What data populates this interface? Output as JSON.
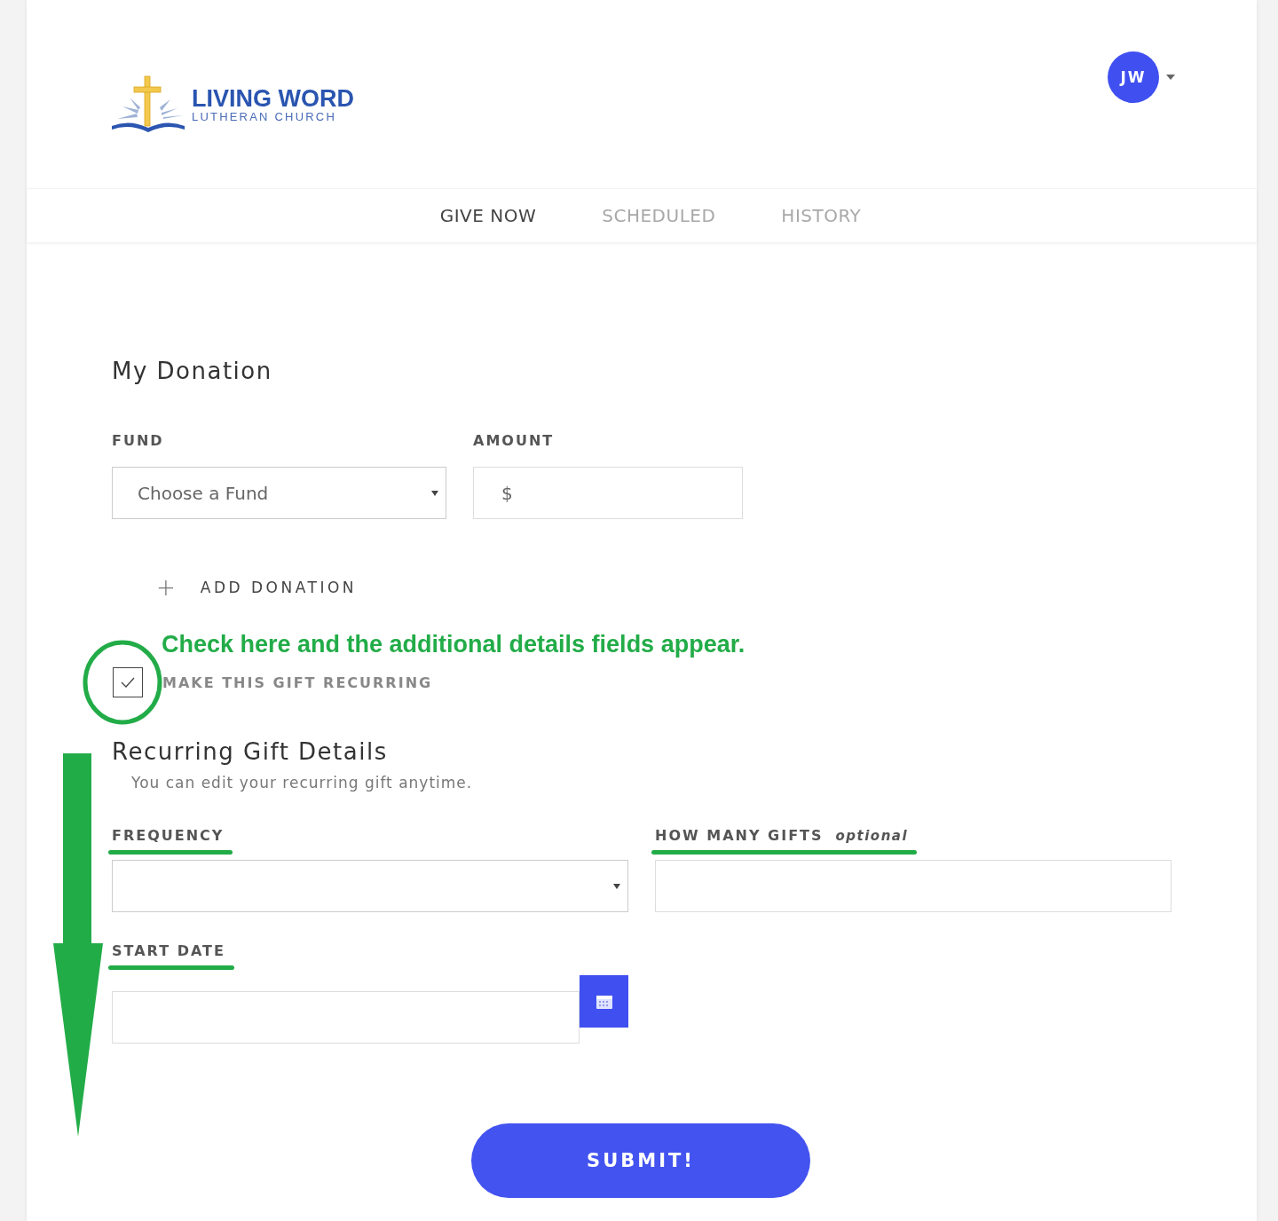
{
  "header": {
    "logo": {
      "title": "LIVING WORD",
      "subtitle": "LUTHERAN CHURCH"
    },
    "avatar": {
      "initials": "JW"
    }
  },
  "tabs": [
    {
      "label": "GIVE NOW",
      "selected": true
    },
    {
      "label": "SCHEDULED",
      "selected": false
    },
    {
      "label": "HISTORY",
      "selected": false
    }
  ],
  "donation": {
    "heading": "My Donation",
    "fields": [
      {
        "kind": "select",
        "label": "FUND",
        "placeholder": "Choose a Fund"
      },
      {
        "kind": "currency",
        "label": "AMOUNT",
        "prefix": "$"
      }
    ],
    "add_button": {
      "icon": "+",
      "label": "ADD DONATION"
    }
  },
  "annotation": {
    "text": "Check here and the additional details fields appear."
  },
  "recurring_checkbox": {
    "label": "MAKE THIS GIFT RECURRING",
    "checked": true,
    "highlighted": true
  },
  "recurring": {
    "heading": "Recurring Gift Details",
    "subtitle": "You can edit your recurring gift anytime.",
    "fields": [
      {
        "kind": "select",
        "label": "FREQUENCY",
        "highlighted": true
      },
      {
        "kind": "text",
        "label": "HOW MANY GIFTS",
        "note": "optional",
        "highlighted": true
      },
      {
        "kind": "date",
        "label": "START DATE",
        "highlighted": true
      }
    ]
  },
  "submit": {
    "label": "SUBMIT!"
  }
}
